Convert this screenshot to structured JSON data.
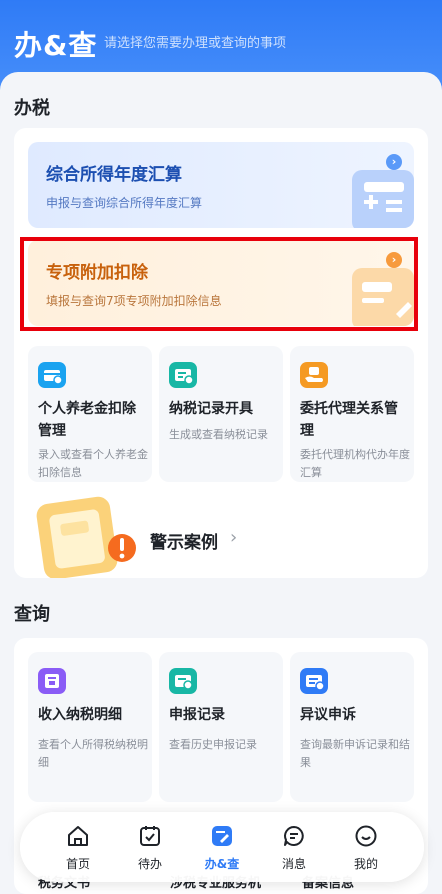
{
  "header": {
    "title": "办&查",
    "subtitle": "请选择您需要办理或查询的事项"
  },
  "tax_section": {
    "title": "办税",
    "banners": [
      {
        "title": "综合所得年度汇算",
        "subtitle": "申报与查询综合所得年度汇算",
        "icon": "chevron-right-icon"
      },
      {
        "title": "专项附加扣除",
        "subtitle": "填报与查询7项专项附加扣除信息",
        "icon": "chevron-right-icon"
      }
    ],
    "tiles": [
      {
        "title": "个人养老金扣除管理",
        "desc": "录入或查看个人养老金扣除信息",
        "icon": "pension-card-icon",
        "color": "#1aa3f0"
      },
      {
        "title": "纳税记录开具",
        "desc": "生成或查看纳税记录",
        "icon": "tax-record-icon",
        "color": "#18b7a5"
      },
      {
        "title": "委托代理关系管理",
        "desc": "委托代理机构代办年度汇算",
        "icon": "agency-hand-icon",
        "color": "#f59a23"
      }
    ],
    "warning": {
      "title": "警示案例",
      "icon": "clipboard-warning-icon"
    }
  },
  "query_section": {
    "title": "查询",
    "tiles": [
      {
        "title": "收入纳税明细",
        "desc": "查看个人所得税纳税明细",
        "icon": "income-detail-icon",
        "color": "#8a5cf6"
      },
      {
        "title": "申报记录",
        "desc": "查看历史申报记录",
        "icon": "declare-record-icon",
        "color": "#18b7a5"
      },
      {
        "title": "异议申诉",
        "desc": "查询最新申诉记录和结果",
        "icon": "appeal-icon",
        "color": "#2f7bf6"
      }
    ],
    "peek": [
      "税务文书",
      "涉税专业服务机",
      "备案信息"
    ]
  },
  "nav": {
    "items": [
      {
        "label": "首页",
        "icon": "home-icon"
      },
      {
        "label": "待办",
        "icon": "calendar-check-icon"
      },
      {
        "label": "办&查",
        "icon": "handle-query-icon",
        "active": true
      },
      {
        "label": "消息",
        "icon": "message-icon"
      },
      {
        "label": "我的",
        "icon": "profile-icon"
      }
    ]
  },
  "colors": {
    "brand": "#2f7bf6",
    "highlight": "#e8000b",
    "orange_title": "#c8610c",
    "blue_title": "#1c4fb1"
  }
}
